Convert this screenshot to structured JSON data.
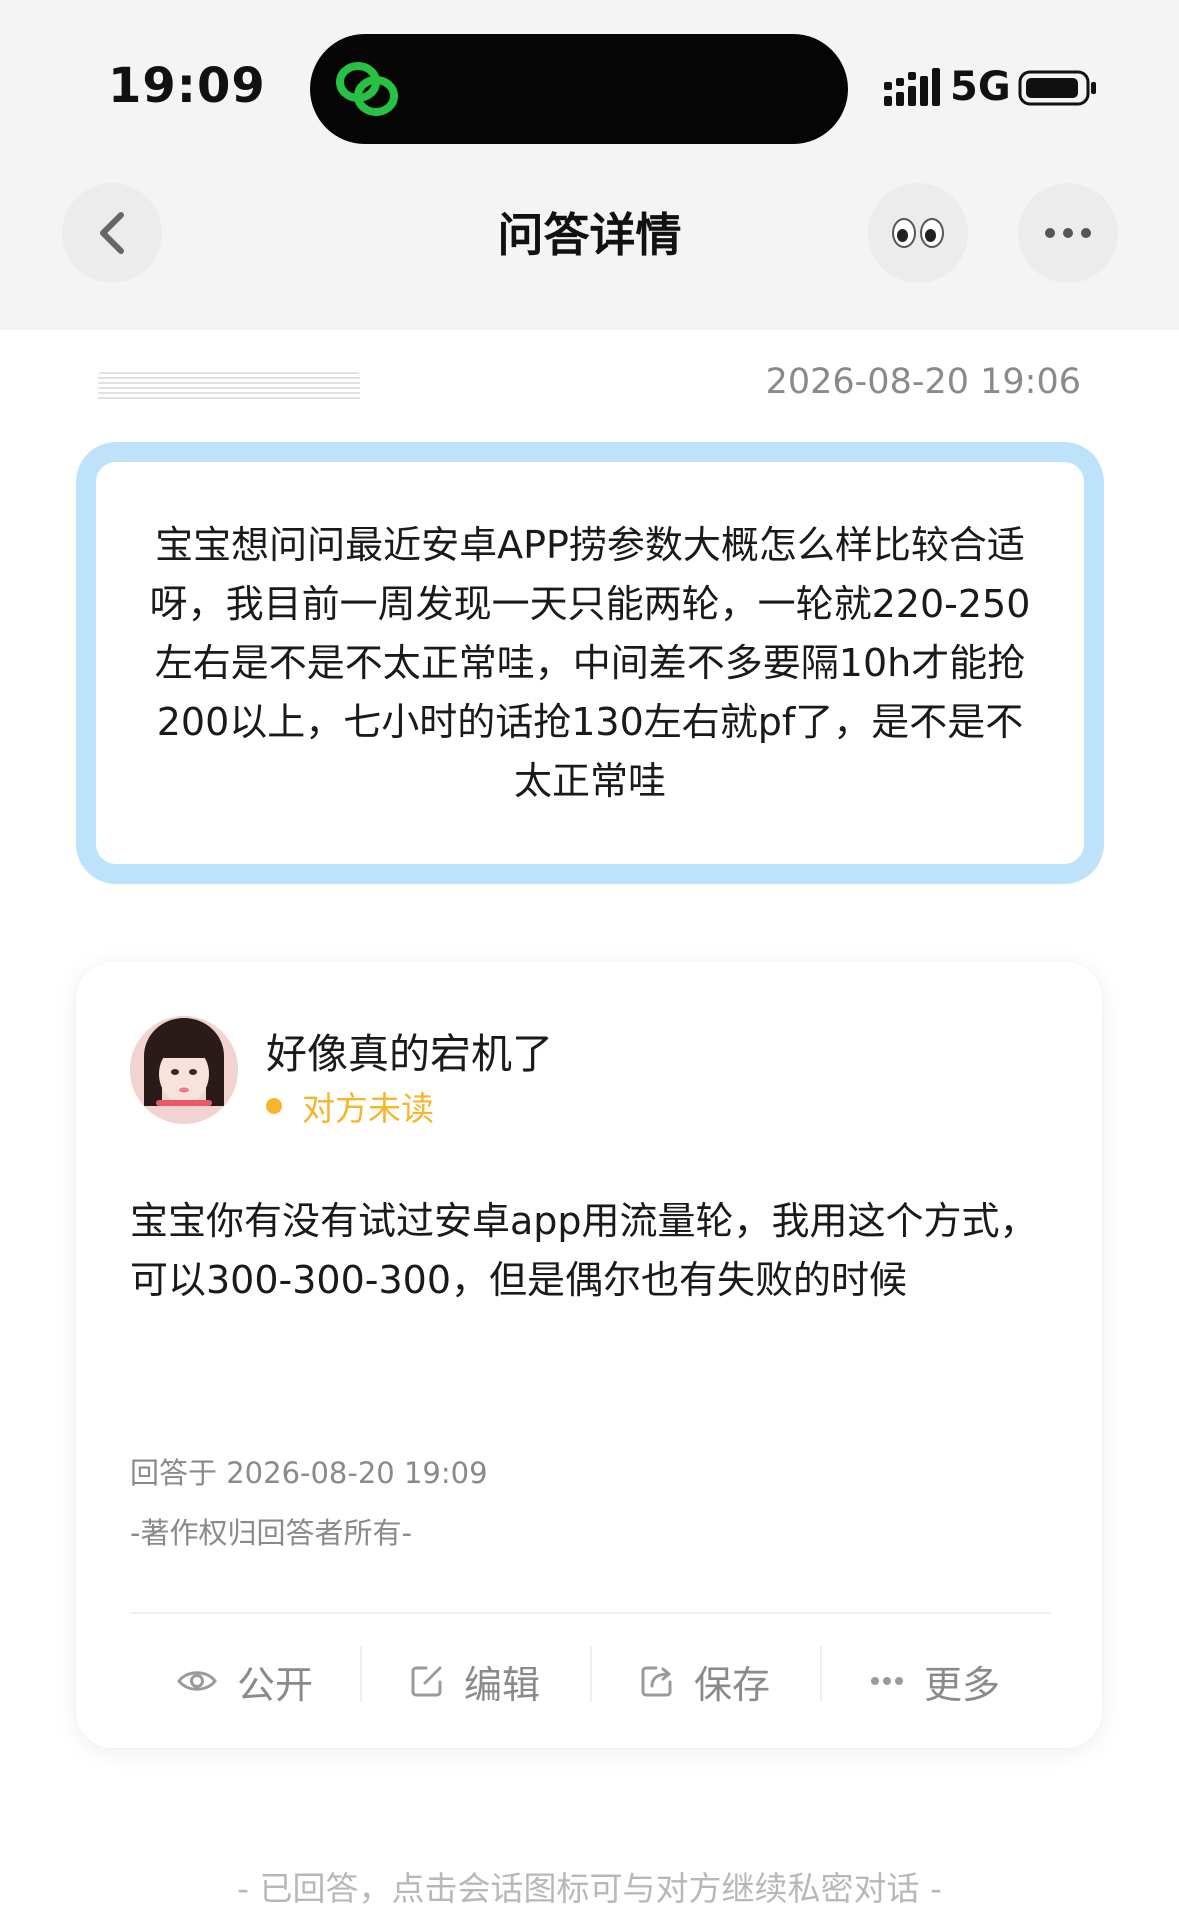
{
  "status_bar": {
    "time": "19:09",
    "network": "5G",
    "app_icon": "link-icon",
    "accent": "#27c244"
  },
  "nav": {
    "title": "问答详情",
    "back_icon": "back-chevron-icon",
    "eyes_icon": "eyes-emoji-icon",
    "more_icon": "more-dots-icon"
  },
  "question": {
    "time": "2026-08-20 19:06",
    "text": "宝宝想问问最近安卓APP捞参数大概怎么样比较合适呀，我目前一周发现一天只能两轮，一轮就220-250左右是不是不太正常哇，中间差不多要隔10h才能抢200以上，七小时的话抢130左右就pf了，是不是不太正常哇",
    "border_color": "#bfe2fb"
  },
  "answer": {
    "name": "好像真的宕机了",
    "read_status": "对方未读",
    "status_color": "#f7b52d",
    "text": "宝宝你有没有试过安卓app用流量轮，我用这个方式，可以300-300-300，但是偶尔也有失败的时候",
    "answered_at": "回答于 2026-08-20 19:09",
    "copyright": "-著作权归回答者所有-",
    "actions": [
      {
        "label": "公开",
        "icon": "eye-icon"
      },
      {
        "label": "编辑",
        "icon": "edit-icon"
      },
      {
        "label": "保存",
        "icon": "share-save-icon"
      },
      {
        "label": "更多",
        "icon": "more-dots-icon"
      }
    ]
  },
  "footer": {
    "hint": "- 已回答，点击会话图标可与对方继续私密对话 -"
  }
}
